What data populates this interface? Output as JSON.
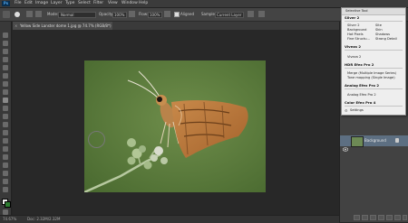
{
  "menubar": {
    "app_badge": "Ps",
    "items": [
      "File",
      "Edit",
      "Image",
      "Layer",
      "Type",
      "Select",
      "Filter",
      "View",
      "Window",
      "Help"
    ]
  },
  "options": {
    "mode_label": "Mode:",
    "mode_value": "Normal",
    "opacity_label": "Opacity:",
    "opacity_value": "100%",
    "flow_label": "Flow:",
    "flow_value": "100%",
    "align_label": "Aligned",
    "sample_label": "Sample:",
    "sample_value": "Current Layer"
  },
  "document": {
    "tab_title": "Yellow Side Lanster dome 1.jpg @ 74.7% (RGB/8*)",
    "zoom": "74.67%",
    "doc_info": "Doc: 2.32M/2.32M"
  },
  "dropdown": {
    "title": "Selective Tool",
    "sections": [
      {
        "name": "Silver 2",
        "items": [
          [
            "Silver 2",
            "Site"
          ],
          [
            "Background",
            "Skin"
          ],
          [
            "Hot Pixels",
            "Shadows"
          ],
          [
            "Fine Structu...",
            "Strong Detail"
          ]
        ]
      },
      {
        "name": "Viveza 2",
        "items": [
          [
            "Viveza 2",
            ""
          ]
        ]
      },
      {
        "name": "HDR Efex Pro 2",
        "items": [
          [
            "Merge (Multiple Image Series)",
            ""
          ],
          [
            "Tone mapping (Single Image)",
            ""
          ]
        ]
      },
      {
        "name": "Analog Efex Pro 2",
        "items": [
          [
            "Analog Efex Pro 2",
            ""
          ]
        ]
      },
      {
        "name": "Color Efex Pro 4",
        "items": []
      }
    ],
    "footer": "Settings"
  },
  "layers": {
    "layer_name": "Background"
  },
  "colors": {
    "photo_bg": "#5b7a3e",
    "selection": "#5d6f82"
  }
}
